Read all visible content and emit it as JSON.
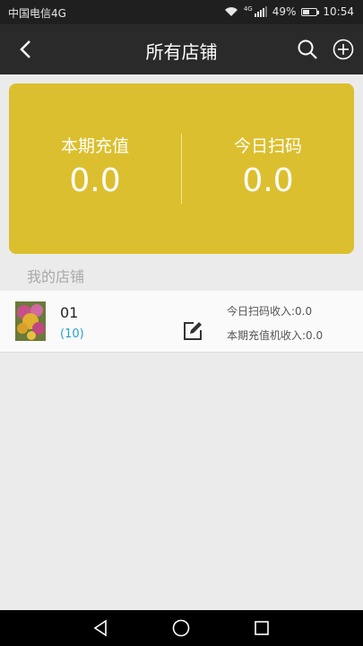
{
  "status_bar": {
    "carrier": "中国电信4G",
    "network": "4G",
    "battery": "49%",
    "battery_level": 0.49,
    "time": "10:54",
    "icons": [
      "wifi-icon",
      "signal-icon",
      "battery-icon"
    ]
  },
  "header": {
    "title": "所有店铺",
    "back_icon": "back-arrow-icon",
    "search_icon": "search-icon",
    "add_icon": "add-circle-icon"
  },
  "summary": {
    "recharge_label": "本期充值",
    "recharge_value": "0.0",
    "scan_label": "今日扫码",
    "scan_value": "0.0",
    "background_color": "#dcbf2e"
  },
  "section": {
    "my_shops_label": "我的店铺"
  },
  "shops": [
    {
      "name": "01",
      "count": "(10)",
      "scan_income": "今日扫码收入:0.0",
      "recharge_income": "本期充值机收入:0.0",
      "edit_icon": "edit-icon",
      "thumbnail": "flower-photo"
    }
  ],
  "nav": {
    "back": "nav-back-icon",
    "home": "nav-home-icon",
    "recent": "nav-recent-icon"
  }
}
